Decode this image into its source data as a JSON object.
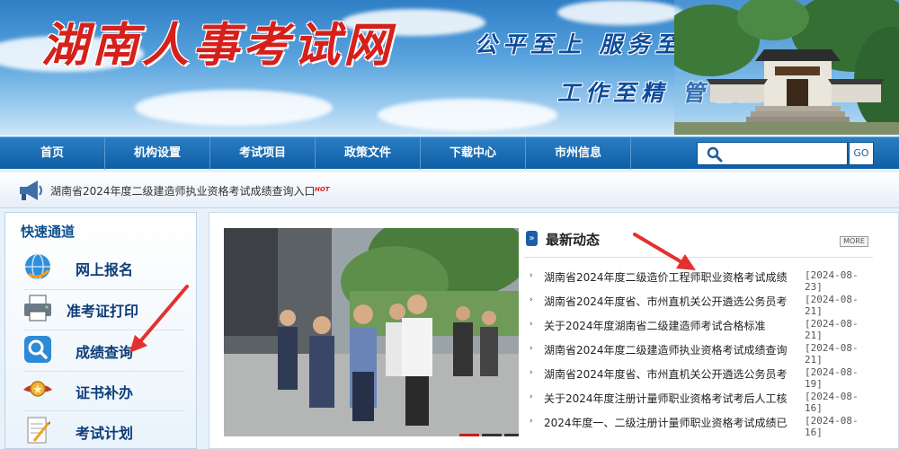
{
  "banner": {
    "site_title": "湖南人事考试网",
    "slogan_1": "公平至上 服务至诚",
    "slogan_2": "工作至精 管理至严"
  },
  "nav": {
    "items": [
      {
        "label": "首页"
      },
      {
        "label": "机构设置"
      },
      {
        "label": "考试项目"
      },
      {
        "label": "政策文件"
      },
      {
        "label": "下载中心"
      },
      {
        "label": "市州信息"
      }
    ],
    "search_placeholder": "",
    "go_label": "GO"
  },
  "notice": {
    "text": "湖南省2024年度二级建造师执业资格考试成绩查询入口",
    "badge": "HOT"
  },
  "sidebar": {
    "title": "快速通道",
    "items": [
      {
        "label": "网上报名",
        "icon": "globe-icon"
      },
      {
        "label": "准考证打印",
        "icon": "printer-icon"
      },
      {
        "label": "成绩查询",
        "icon": "magnifier-icon"
      },
      {
        "label": "证书补办",
        "icon": "medal-icon"
      },
      {
        "label": "考试计划",
        "icon": "notepad-icon"
      }
    ]
  },
  "photo": {
    "pages": [
      "1",
      "2",
      "3"
    ],
    "active_page": "1"
  },
  "news": {
    "title": "最新动态",
    "more_label": "MORE",
    "items": [
      {
        "title": "湖南省2024年度二级造价工程师职业资格考试成绩",
        "date": "[2024-08-23]"
      },
      {
        "title": "湖南省2024年度省、市州直机关公开遴选公务员考",
        "date": "[2024-08-21]"
      },
      {
        "title": "关于2024年度湖南省二级建造师考试合格标准",
        "date": "[2024-08-21]"
      },
      {
        "title": "湖南省2024年度二级建造师执业资格考试成绩查询",
        "date": "[2024-08-21]"
      },
      {
        "title": "湖南省2024年度省、市州直机关公开遴选公务员考",
        "date": "[2024-08-19]"
      },
      {
        "title": "关于2024年度注册计量师职业资格考试考后人工核",
        "date": "[2024-08-16]"
      },
      {
        "title": "2024年度一、二级注册计量师职业资格考试成绩已",
        "date": "[2024-08-16]"
      }
    ]
  },
  "colors": {
    "nav_bg": "#0f5ea5",
    "title_red": "#d6201b",
    "slogan_blue": "#0d4b9b",
    "annotation_red": "#e53030"
  }
}
